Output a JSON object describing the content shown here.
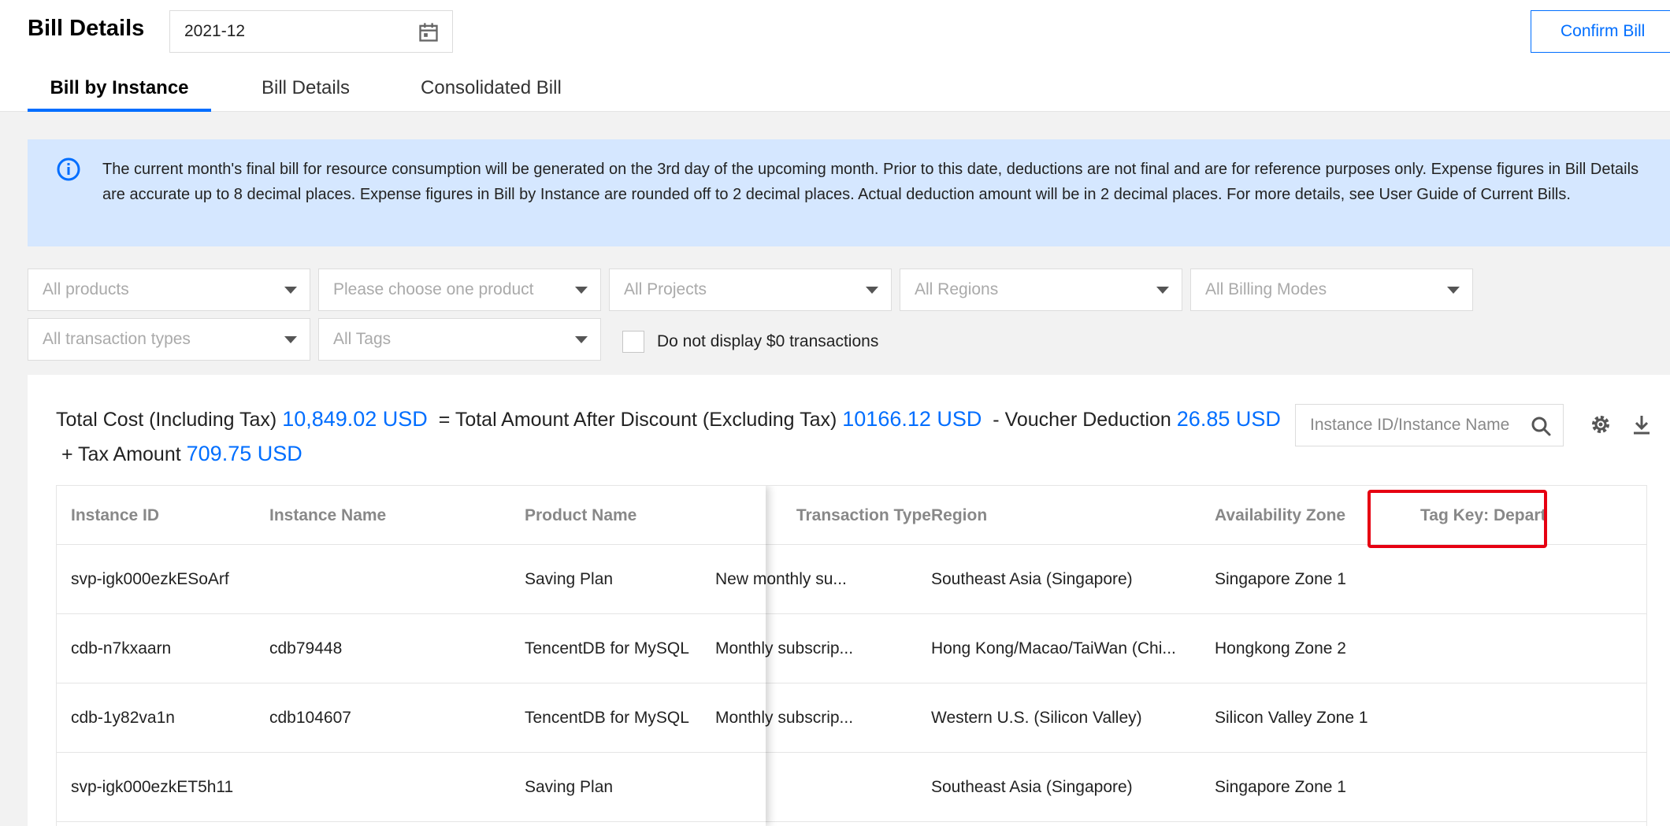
{
  "header": {
    "title": "Bill Details",
    "month": "2021-12",
    "confirm_label": "Confirm Bill",
    "tabs": [
      {
        "label": "Bill by Instance",
        "active": true
      },
      {
        "label": "Bill Details",
        "active": false
      },
      {
        "label": "Consolidated Bill",
        "active": false
      }
    ]
  },
  "notice": {
    "text": "The current month's final bill for resource consumption will be generated on the 3rd day of the upcoming month. Prior to this date, deductions are not final and are for reference purposes only. Expense figures in Bill Details are accurate up to 8 decimal places. Expense figures in Bill by Instance are rounded off to 2 decimal places. Actual deduction amount will be in 2 decimal places. For more details, see User Guide of Current Bills."
  },
  "filters": {
    "products": "All products",
    "product_detail": "Please choose one product",
    "projects": "All Projects",
    "regions": "All Regions",
    "billing_modes": "All Billing Modes",
    "transaction_types": "All transaction types",
    "tags": "All Tags",
    "hide_zero_label": "Do not display $0 transactions"
  },
  "summary": {
    "total_label": "Total Cost (Including Tax)",
    "total_value": "10,849.02 USD",
    "after_discount_label": "= Total Amount After Discount (Excluding Tax)",
    "after_discount_value": "10166.12 USD",
    "voucher_label": "- Voucher Deduction",
    "voucher_value": "26.85 USD",
    "tax_label": "+ Tax Amount",
    "tax_value": "709.75 USD"
  },
  "search": {
    "placeholder": "Instance ID/Instance Name"
  },
  "table": {
    "headers": {
      "instance_id": "Instance ID",
      "instance_name": "Instance Name",
      "product_name": "Product Name",
      "transaction_type": "Transaction Type",
      "region": "Region",
      "availability_zone": "Availability Zone",
      "tag_key": "Tag Key: Depart"
    },
    "rows": [
      {
        "instance_id": "svp-igk000ezkESoArf",
        "instance_name": "",
        "product_name": "Saving Plan",
        "transaction_type": "New monthly su...",
        "region": "Southeast Asia (Singapore)",
        "availability_zone": "Singapore Zone 1",
        "tag": ""
      },
      {
        "instance_id": "cdb-n7kxaarn",
        "instance_name": "cdb79448",
        "product_name": "TencentDB for MySQL",
        "transaction_type": "Monthly subscrip...",
        "region": "Hong Kong/Macao/TaiWan (Chi...",
        "availability_zone": "Hongkong Zone 2",
        "tag": ""
      },
      {
        "instance_id": "cdb-1y82va1n",
        "instance_name": "cdb104607",
        "product_name": "TencentDB for MySQL",
        "transaction_type": "Monthly subscrip...",
        "region": "Western U.S. (Silicon Valley)",
        "availability_zone": "Silicon Valley Zone 1",
        "tag": ""
      },
      {
        "instance_id": "svp-igk000ezkET5h11",
        "instance_name": "",
        "product_name": "Saving Plan",
        "transaction_type": "",
        "region": "Southeast Asia (Singapore)",
        "availability_zone": "Singapore Zone 1",
        "tag": ""
      }
    ]
  },
  "colors": {
    "accent": "#006eff",
    "notice_bg": "#d5e7ff",
    "highlight": "#e60012"
  },
  "icons": [
    "calendar-icon",
    "info-icon",
    "caret-down-icon",
    "search-icon",
    "gear-icon",
    "download-icon"
  ]
}
